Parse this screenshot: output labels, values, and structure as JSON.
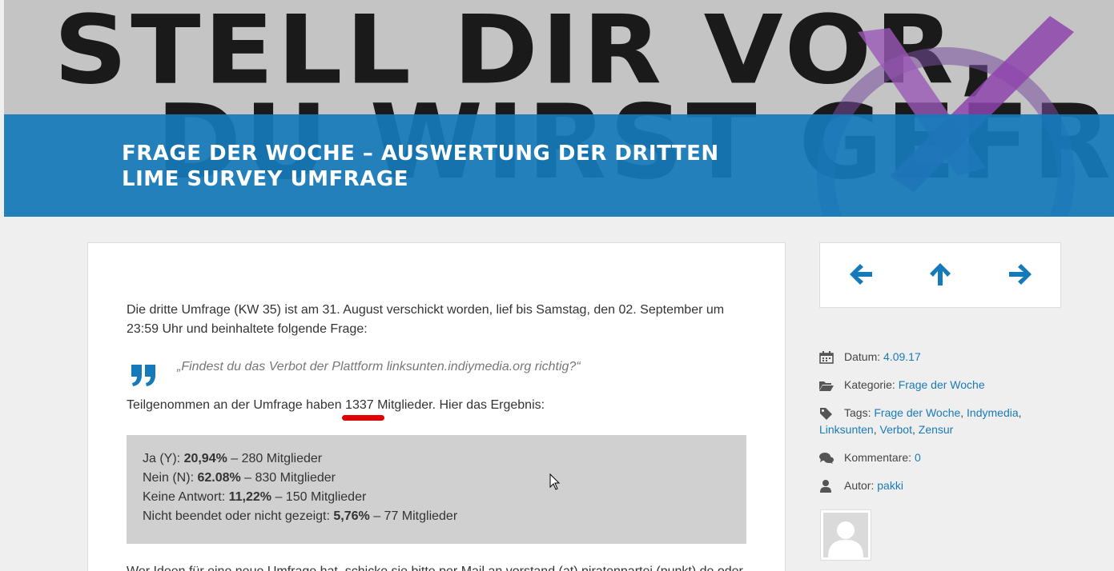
{
  "hero": {
    "banner_line1": "STELL DIR VOR,",
    "banner_line2": "DU WIRST GEFRAGT!",
    "title": "Frage der Woche – Auswertung der dritten Lime Survey Umfrage"
  },
  "article": {
    "intro": "Die dritte Umfrage (KW 35) ist am 31. August verschickt worden, lief bis Samstag, den 02. September um 23:59 Uhr und beinhaltete folgende Frage:",
    "quote": "„Findest du das Verbot der Plattform linksunten.indiymedia.org richtig?“",
    "participation_prefix": "Teilgenommen an der Umfrage haben ",
    "participation_count": "1337",
    "participation_suffix": " Mitglieder. Hier das Ergebnis:",
    "results": [
      {
        "label": "Ja (Y): ",
        "percent": "20,94%",
        "rest": " – 280 Mitglieder"
      },
      {
        "label": "Nein (N): ",
        "percent": "62.08%",
        "rest": " – 830 Mitglieder"
      },
      {
        "label": "Keine Antwort: ",
        "percent": "11,22%",
        "rest": " – 150 Mitglieder"
      },
      {
        "label": "Nicht beendet oder nicht gezeigt: ",
        "percent": "5,76%",
        "rest": " – 77 Mitglieder"
      }
    ],
    "cut_text": "Wer Ideen für eine neue Umfrage hat, schicke sie bitte per Mail an vorstand (at) piratenpartei (punkt) de oder"
  },
  "sidebar": {
    "date_label": "Datum: ",
    "date_value": "4.09.17",
    "category_label": "Kategorie: ",
    "category_value": "Frage der Woche",
    "tags_label": "Tags: ",
    "tags": [
      "Frage der Woche",
      "Indymedia",
      "Linksunten",
      "Verbot",
      "Zensur"
    ],
    "tag_sep": ", ",
    "comments_label": "Kommentare: ",
    "comments_value": "0",
    "author_label": "Autor: ",
    "author_value": "pakki"
  },
  "colors": {
    "accent": "#157aba",
    "link": "#1a7ab8",
    "highlight": "#e00000"
  },
  "icons": {
    "nav": [
      "arrow-left-icon",
      "arrow-up-icon",
      "arrow-right-icon"
    ],
    "meta": [
      "calendar-icon",
      "folder-icon",
      "tag-icon",
      "comments-icon",
      "user-icon"
    ]
  }
}
